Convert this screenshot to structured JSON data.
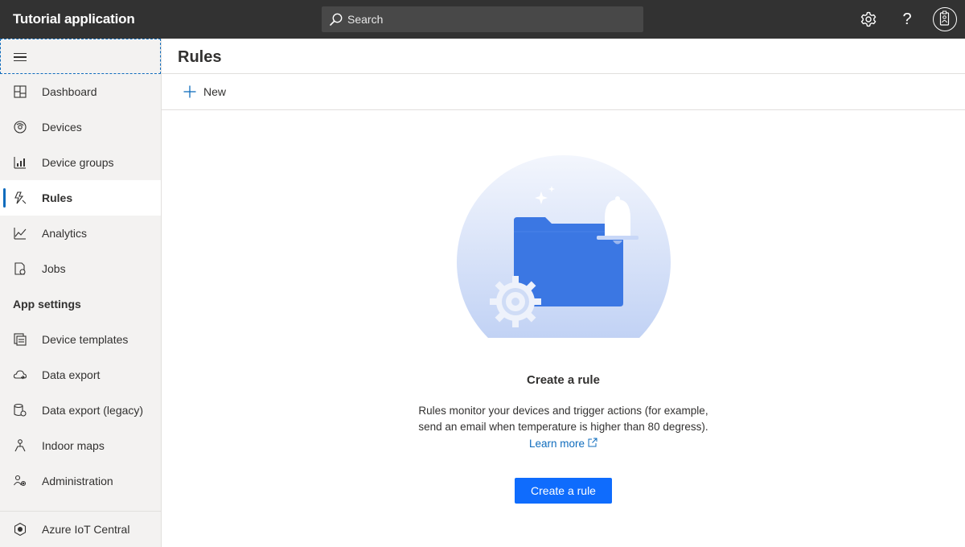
{
  "header": {
    "app_title": "Tutorial application",
    "search_placeholder": "Search",
    "settings_icon": "gear-icon",
    "help_icon": "help-icon",
    "help_glyph": "?",
    "avatar_icon": "user-avatar-icon"
  },
  "sidebar": {
    "items": [
      {
        "label": "Dashboard",
        "icon": "dashboard-icon"
      },
      {
        "label": "Devices",
        "icon": "devices-icon"
      },
      {
        "label": "Device groups",
        "icon": "device-groups-icon"
      },
      {
        "label": "Rules",
        "icon": "rules-icon",
        "active": true
      },
      {
        "label": "Analytics",
        "icon": "analytics-icon"
      },
      {
        "label": "Jobs",
        "icon": "jobs-icon"
      }
    ],
    "app_settings_header": "App settings",
    "settings_items": [
      {
        "label": "Device templates",
        "icon": "device-templates-icon"
      },
      {
        "label": "Data export",
        "icon": "data-export-icon"
      },
      {
        "label": "Data export (legacy)",
        "icon": "data-export-legacy-icon"
      },
      {
        "label": "Indoor maps",
        "icon": "indoor-maps-icon"
      },
      {
        "label": "Administration",
        "icon": "administration-icon"
      }
    ],
    "footer_item": {
      "label": "Azure IoT Central",
      "icon": "azure-iot-central-icon"
    }
  },
  "main": {
    "page_title": "Rules",
    "toolbar": {
      "new_label": "New"
    },
    "empty_state": {
      "title": "Create a rule",
      "description_line1": "Rules monitor your devices and trigger actions (for example,",
      "description_line2": "send an email when temperature is higher than 80 degress).",
      "learn_more": "Learn more",
      "button_label": "Create a rule"
    }
  },
  "colors": {
    "topbar": "#323232",
    "accent": "#0f6cbd",
    "primary_button": "#0f6cfd",
    "sidebar_bg": "#f3f2f1",
    "folder_blue": "#3b77e3"
  }
}
